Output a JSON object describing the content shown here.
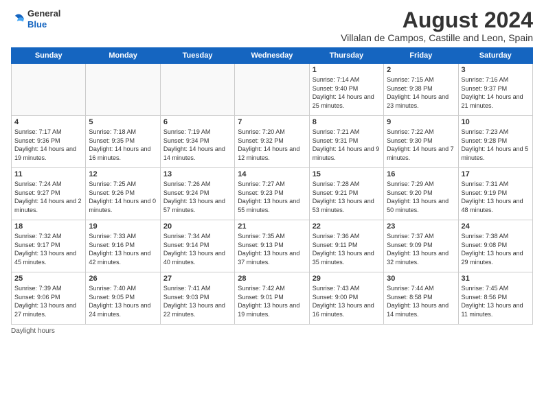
{
  "logo": {
    "general": "General",
    "blue": "Blue"
  },
  "title": "August 2024",
  "subtitle": "Villalan de Campos, Castille and Leon, Spain",
  "days_header": [
    "Sunday",
    "Monday",
    "Tuesday",
    "Wednesday",
    "Thursday",
    "Friday",
    "Saturday"
  ],
  "footer": "Daylight hours",
  "weeks": [
    [
      {
        "day": "",
        "info": ""
      },
      {
        "day": "",
        "info": ""
      },
      {
        "day": "",
        "info": ""
      },
      {
        "day": "",
        "info": ""
      },
      {
        "day": "1",
        "info": "Sunrise: 7:14 AM\nSunset: 9:40 PM\nDaylight: 14 hours and 25 minutes."
      },
      {
        "day": "2",
        "info": "Sunrise: 7:15 AM\nSunset: 9:38 PM\nDaylight: 14 hours and 23 minutes."
      },
      {
        "day": "3",
        "info": "Sunrise: 7:16 AM\nSunset: 9:37 PM\nDaylight: 14 hours and 21 minutes."
      }
    ],
    [
      {
        "day": "4",
        "info": "Sunrise: 7:17 AM\nSunset: 9:36 PM\nDaylight: 14 hours and 19 minutes."
      },
      {
        "day": "5",
        "info": "Sunrise: 7:18 AM\nSunset: 9:35 PM\nDaylight: 14 hours and 16 minutes."
      },
      {
        "day": "6",
        "info": "Sunrise: 7:19 AM\nSunset: 9:34 PM\nDaylight: 14 hours and 14 minutes."
      },
      {
        "day": "7",
        "info": "Sunrise: 7:20 AM\nSunset: 9:32 PM\nDaylight: 14 hours and 12 minutes."
      },
      {
        "day": "8",
        "info": "Sunrise: 7:21 AM\nSunset: 9:31 PM\nDaylight: 14 hours and 9 minutes."
      },
      {
        "day": "9",
        "info": "Sunrise: 7:22 AM\nSunset: 9:30 PM\nDaylight: 14 hours and 7 minutes."
      },
      {
        "day": "10",
        "info": "Sunrise: 7:23 AM\nSunset: 9:28 PM\nDaylight: 14 hours and 5 minutes."
      }
    ],
    [
      {
        "day": "11",
        "info": "Sunrise: 7:24 AM\nSunset: 9:27 PM\nDaylight: 14 hours and 2 minutes."
      },
      {
        "day": "12",
        "info": "Sunrise: 7:25 AM\nSunset: 9:26 PM\nDaylight: 14 hours and 0 minutes."
      },
      {
        "day": "13",
        "info": "Sunrise: 7:26 AM\nSunset: 9:24 PM\nDaylight: 13 hours and 57 minutes."
      },
      {
        "day": "14",
        "info": "Sunrise: 7:27 AM\nSunset: 9:23 PM\nDaylight: 13 hours and 55 minutes."
      },
      {
        "day": "15",
        "info": "Sunrise: 7:28 AM\nSunset: 9:21 PM\nDaylight: 13 hours and 53 minutes."
      },
      {
        "day": "16",
        "info": "Sunrise: 7:29 AM\nSunset: 9:20 PM\nDaylight: 13 hours and 50 minutes."
      },
      {
        "day": "17",
        "info": "Sunrise: 7:31 AM\nSunset: 9:19 PM\nDaylight: 13 hours and 48 minutes."
      }
    ],
    [
      {
        "day": "18",
        "info": "Sunrise: 7:32 AM\nSunset: 9:17 PM\nDaylight: 13 hours and 45 minutes."
      },
      {
        "day": "19",
        "info": "Sunrise: 7:33 AM\nSunset: 9:16 PM\nDaylight: 13 hours and 42 minutes."
      },
      {
        "day": "20",
        "info": "Sunrise: 7:34 AM\nSunset: 9:14 PM\nDaylight: 13 hours and 40 minutes."
      },
      {
        "day": "21",
        "info": "Sunrise: 7:35 AM\nSunset: 9:13 PM\nDaylight: 13 hours and 37 minutes."
      },
      {
        "day": "22",
        "info": "Sunrise: 7:36 AM\nSunset: 9:11 PM\nDaylight: 13 hours and 35 minutes."
      },
      {
        "day": "23",
        "info": "Sunrise: 7:37 AM\nSunset: 9:09 PM\nDaylight: 13 hours and 32 minutes."
      },
      {
        "day": "24",
        "info": "Sunrise: 7:38 AM\nSunset: 9:08 PM\nDaylight: 13 hours and 29 minutes."
      }
    ],
    [
      {
        "day": "25",
        "info": "Sunrise: 7:39 AM\nSunset: 9:06 PM\nDaylight: 13 hours and 27 minutes."
      },
      {
        "day": "26",
        "info": "Sunrise: 7:40 AM\nSunset: 9:05 PM\nDaylight: 13 hours and 24 minutes."
      },
      {
        "day": "27",
        "info": "Sunrise: 7:41 AM\nSunset: 9:03 PM\nDaylight: 13 hours and 22 minutes."
      },
      {
        "day": "28",
        "info": "Sunrise: 7:42 AM\nSunset: 9:01 PM\nDaylight: 13 hours and 19 minutes."
      },
      {
        "day": "29",
        "info": "Sunrise: 7:43 AM\nSunset: 9:00 PM\nDaylight: 13 hours and 16 minutes."
      },
      {
        "day": "30",
        "info": "Sunrise: 7:44 AM\nSunset: 8:58 PM\nDaylight: 13 hours and 14 minutes."
      },
      {
        "day": "31",
        "info": "Sunrise: 7:45 AM\nSunset: 8:56 PM\nDaylight: 13 hours and 11 minutes."
      }
    ]
  ]
}
